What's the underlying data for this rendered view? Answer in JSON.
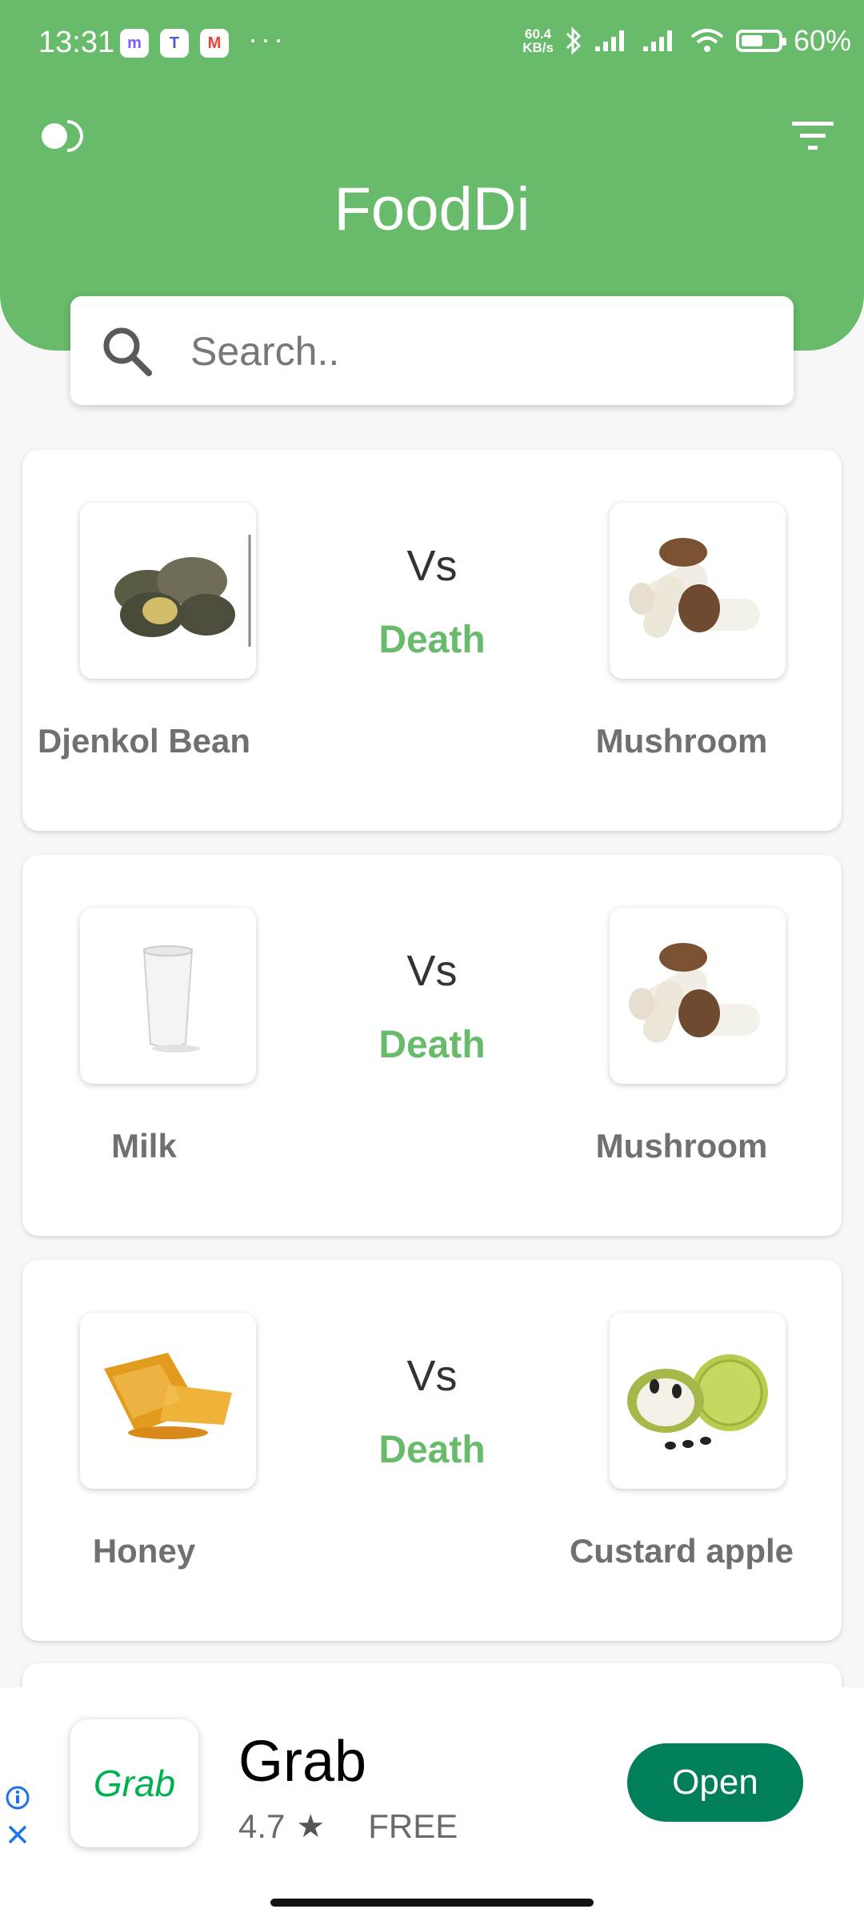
{
  "status_bar": {
    "time": "13:31",
    "net_speed_value": "60.4",
    "net_speed_unit": "KB/s",
    "battery_text": "60%",
    "battery_level": 0.6,
    "more": "···",
    "apps": [
      {
        "icon": "messenger-icon",
        "color": "#7b5cff",
        "glyph": "m"
      },
      {
        "icon": "teams-icon",
        "color": "#5059c9",
        "glyph": "T"
      },
      {
        "icon": "gmail-icon",
        "color": "#ea4335",
        "glyph": "M"
      }
    ]
  },
  "header": {
    "title": "FoodDi",
    "color": "#67bb6a",
    "theme_toggle_icon": "theme-toggle-icon",
    "filter_icon": "filter-icon"
  },
  "search": {
    "placeholder": "Search..",
    "value": ""
  },
  "comparisons": [
    {
      "left": "Djenkol Bean",
      "vs": "Vs",
      "result": "Death",
      "right": "Mushroom"
    },
    {
      "left": "Milk",
      "vs": "Vs",
      "result": "Death",
      "right": "Mushroom"
    },
    {
      "left": "Honey",
      "vs": "Vs",
      "result": "Death",
      "right": "Custard apple"
    }
  ],
  "ad": {
    "app_name": "Grab",
    "logo_text": "Grab",
    "rating": "4.7",
    "price": "FREE",
    "button": "Open",
    "button_color": "#017f5b"
  }
}
